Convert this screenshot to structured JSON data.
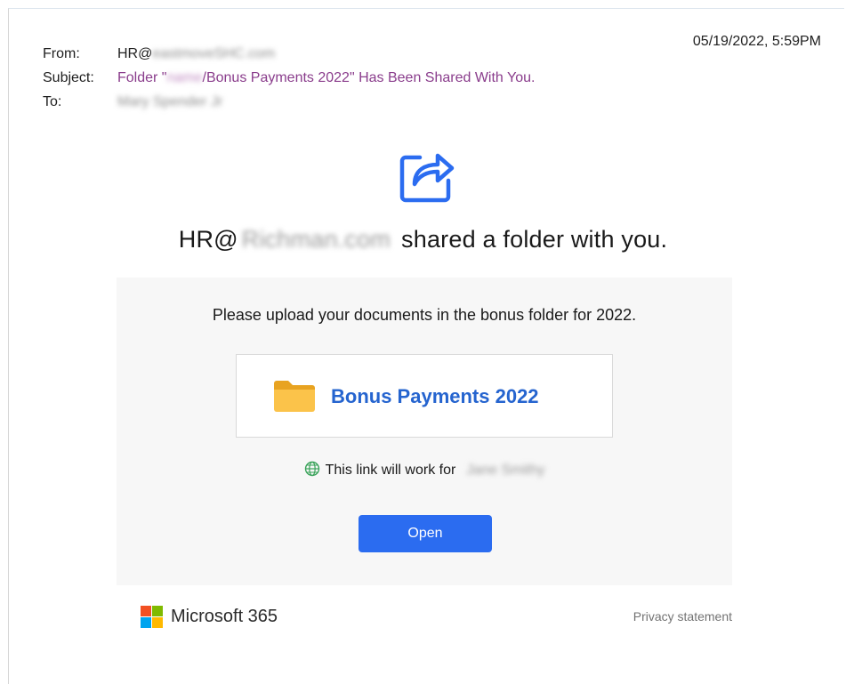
{
  "header": {
    "from_label": "From:",
    "from_value": "HR@",
    "from_redacted": "eastmoveSHC.com",
    "subject_label": "Subject:",
    "subject_prefix": "Folder \"",
    "subject_redacted": "name",
    "subject_suffix": "/Bonus Payments 2022\" Has Been Shared With You.",
    "to_label": "To:",
    "to_redacted": "Mary Spender Jr",
    "date": "05/19/2022, 5:59PM"
  },
  "body": {
    "sender_prefix": "HR@",
    "sender_redacted": "Richman.com",
    "headline_suffix": "shared a folder with you.",
    "message": "Please upload your documents in the bonus folder for 2022.",
    "folder_name": "Bonus Payments 2022",
    "link_note": "This link will work for",
    "link_recipient_redacted": "Jane Smithy",
    "open_label": "Open"
  },
  "footer": {
    "brand": "Microsoft 365",
    "privacy": "Privacy statement"
  },
  "colors": {
    "accent_blue": "#2564cf",
    "button_blue": "#2b6cf0",
    "subject_purple": "#8a3d8c",
    "folder_yellow": "#f4b63f",
    "ms_red": "#f25022",
    "ms_green": "#7fba00",
    "ms_blue": "#00a4ef",
    "ms_yellow": "#ffb900"
  },
  "icons": {
    "share": "share-arrow-icon",
    "folder": "folder-icon",
    "globe": "globe-icon",
    "logo": "microsoft-logo-icon"
  }
}
